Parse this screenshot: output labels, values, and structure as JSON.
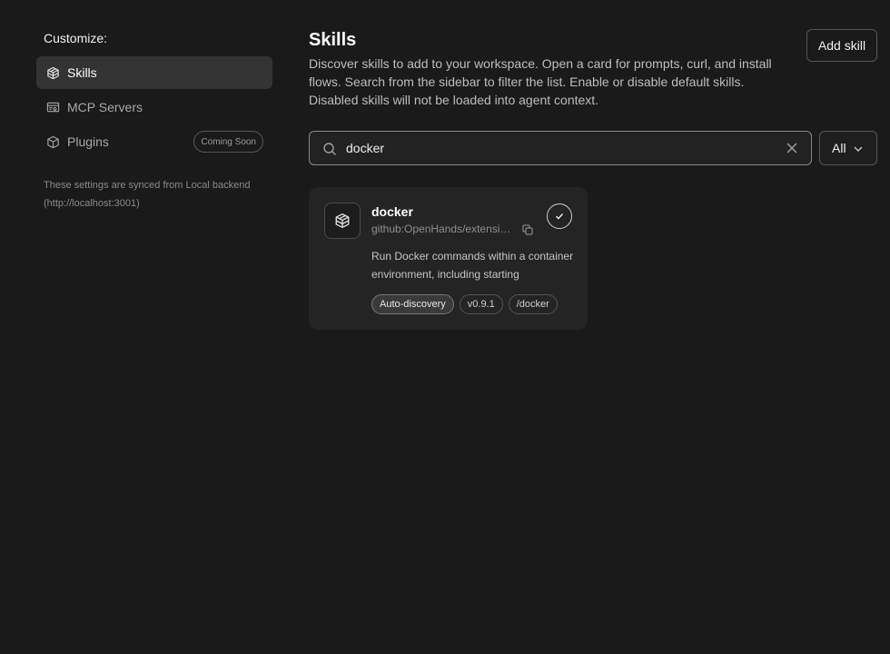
{
  "sidebar": {
    "title": "Customize:",
    "items": [
      {
        "label": "Skills",
        "icon": "cube-icon",
        "active": true
      },
      {
        "label": "MCP Servers",
        "icon": "server-settings-icon",
        "active": false
      },
      {
        "label": "Plugins",
        "icon": "package-icon",
        "active": false,
        "badge": "Coming Soon"
      }
    ],
    "sync_note": "These settings are synced from Local backend (http://localhost:3001)"
  },
  "main": {
    "title": "Skills",
    "description": "Discover skills to add to your workspace. Open a card for prompts, curl, and install flows. Search from the sidebar to filter the list. Enable or disable default skills. Disabled skills will not be loaded into agent context.",
    "add_button_label": "Add skill",
    "search": {
      "value": "docker",
      "placeholder": ""
    },
    "filter": {
      "selected": "All"
    },
    "cards": [
      {
        "name": "docker",
        "source": "github:OpenHands/extensions",
        "description": "Run Docker commands within a container environment, including starting",
        "enabled": true,
        "tags": [
          "Auto-discovery",
          "v0.9.1",
          "/docker"
        ]
      }
    ]
  },
  "colors": {
    "background": "#1a1a1a",
    "card": "#242424",
    "active_nav": "#333333"
  }
}
